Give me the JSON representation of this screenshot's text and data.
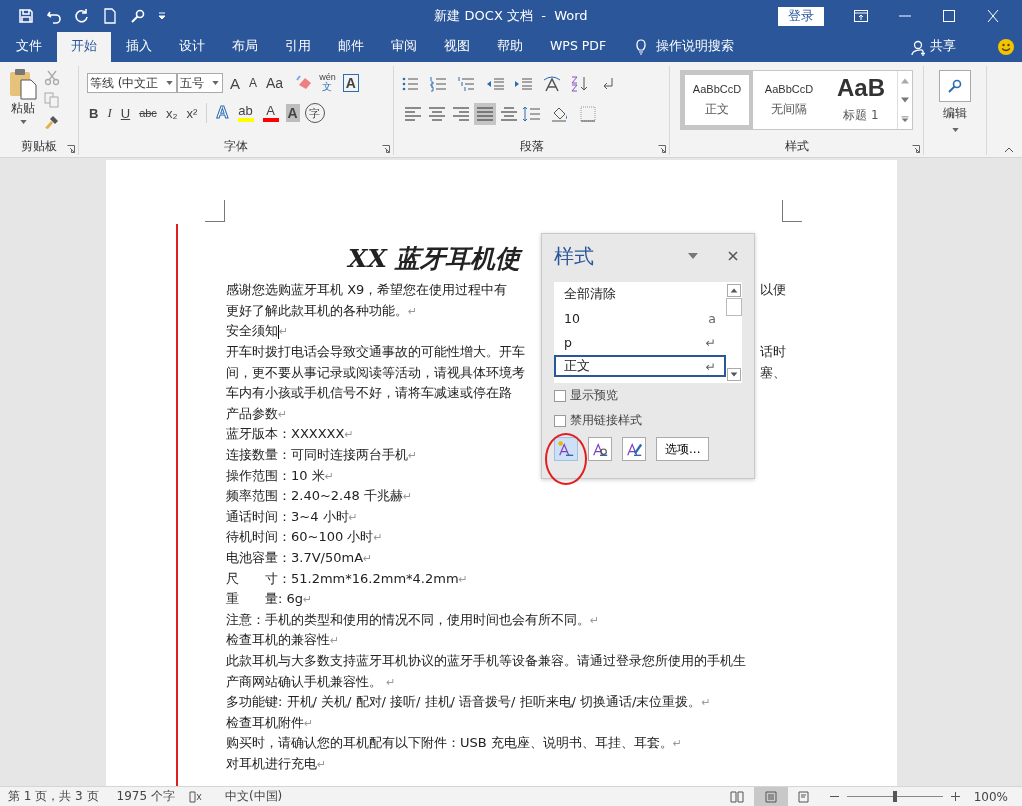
{
  "window": {
    "title": "新建 DOCX 文档  -  Word",
    "login": "登录"
  },
  "tabs": [
    {
      "label": "文件",
      "selected": false
    },
    {
      "label": "开始",
      "selected": true
    },
    {
      "label": "插入",
      "selected": false
    },
    {
      "label": "设计",
      "selected": false
    },
    {
      "label": "布局",
      "selected": false
    },
    {
      "label": "引用",
      "selected": false
    },
    {
      "label": "邮件",
      "selected": false
    },
    {
      "label": "审阅",
      "selected": false
    },
    {
      "label": "视图",
      "selected": false
    },
    {
      "label": "帮助",
      "selected": false
    },
    {
      "label": "WPS PDF",
      "selected": false
    }
  ],
  "tell_me": "操作说明搜索",
  "share": "共享",
  "clipboard": {
    "paste": "粘贴",
    "group": "剪贴板"
  },
  "font": {
    "name": "等线 (中文正",
    "size": "五号",
    "group": "字体",
    "row1": [
      "A",
      "A",
      "Aa"
    ],
    "phonetic": "wén",
    "phonetic_char": "文",
    "boxed": "A",
    "row2": [
      {
        "label": "B",
        "kind": "bold"
      },
      {
        "label": "I",
        "kind": "italic"
      },
      {
        "label": "U",
        "kind": "underline"
      },
      {
        "label": "abc",
        "kind": "strike"
      },
      {
        "label": "x₂",
        "kind": "plain"
      },
      {
        "label": "x²",
        "kind": "plain"
      }
    ],
    "row3": [
      {
        "label": "A",
        "kind": "effect"
      },
      {
        "label": "ab",
        "kind": "highlight",
        "color": "#ffff00"
      },
      {
        "label": "A",
        "kind": "fontcolor",
        "color": "#ff0000"
      },
      {
        "label": "A",
        "kind": "shade"
      },
      {
        "label": "字",
        "kind": "circle"
      }
    ]
  },
  "paragraph": {
    "group": "段落",
    "alignment": [
      {
        "kind": "left",
        "selected": false
      },
      {
        "kind": "center",
        "selected": false
      },
      {
        "kind": "right",
        "selected": false
      },
      {
        "kind": "justify",
        "selected": true
      },
      {
        "kind": "distribute",
        "selected": false
      }
    ]
  },
  "styles": {
    "group": "样式",
    "items": [
      {
        "preview": "AaBbCcD",
        "label": "正文",
        "kind": "normal",
        "selected": true
      },
      {
        "preview": "AaBbCcD",
        "label": "无间隔",
        "kind": "normal",
        "selected": false
      },
      {
        "preview": "AaB",
        "label": "标题 1",
        "kind": "heading",
        "selected": false
      }
    ]
  },
  "editing": {
    "label": "编辑"
  },
  "document": {
    "title": "XX 蓝牙耳机使",
    "lines": [
      {
        "text": "感谢您选购蓝牙耳机 X9，希望您在使用过程中有",
        "tail": "以便"
      },
      {
        "text": "更好了解此款耳机的各种功能。",
        "end": "↵"
      },
      {
        "text": "安全须知",
        "end": "↵",
        "cursor": true
      },
      {
        "text": "开车时拨打电话会导致交通事故的可能性增大。开车",
        "tail": "话时"
      },
      {
        "text": "间，更不要从事记录或阅读等活动，请视具体环境考",
        "tail": "塞、"
      },
      {
        "text": "车内有小孩或手机信号不好，请将车减速或停在路"
      },
      {
        "text": "产品参数",
        "end": "↵"
      },
      {
        "text": "蓝牙版本：XXXXXX",
        "end": "↵"
      },
      {
        "text": "连接数量：可同时连接两台手机",
        "end": "↵"
      },
      {
        "text": "操作范围：10 米",
        "end": "↵"
      },
      {
        "text": "频率范围：2.40~2.48 千兆赫",
        "end": "↵"
      },
      {
        "text": "通话时间：3~4 小时",
        "end": "↵"
      },
      {
        "text": "待机时间：60~100 小时",
        "end": "↵"
      },
      {
        "text": "电池容量：3.7V/50mA",
        "end": "↵"
      },
      {
        "text": "尺　　寸：51.2mm*16.2mm*4.2mm",
        "end": "↵"
      },
      {
        "text": "重　　量: 6g",
        "end": "↵"
      },
      {
        "text": "注意：手机的类型和使用的情况不同，使用时间也会有所不同。",
        "end": "↵"
      },
      {
        "text": "检查耳机的兼容性",
        "end": "↵"
      },
      {
        "text": "此款耳机与大多数支持蓝牙耳机协议的蓝牙手机等设备兼容。请通过登录您所使用的手机生"
      },
      {
        "text": "产商网站确认手机兼容性。 ",
        "end": "↵"
      },
      {
        "text": "多功能键: 开机/ 关机/ 配对/ 接听/ 挂机/ 语音拨号/ 拒听来电/ 切换通话/末位重拨。",
        "end": "↵"
      },
      {
        "text": "检查耳机附件",
        "end": "↵"
      },
      {
        "text": "购买时，请确认您的耳机配有以下附件：USB 充电座、说明书、耳挂、耳套。",
        "end": "↵"
      },
      {
        "text": "对耳机进行充电",
        "end": "↵"
      }
    ]
  },
  "styles_pane": {
    "title": "样式",
    "items": [
      {
        "label": "全部清除",
        "selected": false
      },
      {
        "label": "10",
        "mark": "a",
        "selected": false
      },
      {
        "label": "p",
        "mark": "↵",
        "selected": false
      },
      {
        "label": "正文",
        "mark": "↵",
        "selected": true
      }
    ],
    "checkboxes": [
      {
        "label": "显示预览",
        "checked": false
      },
      {
        "label": "禁用链接样式",
        "checked": false
      }
    ],
    "tools": [
      {
        "kind": "new",
        "selected": true
      },
      {
        "kind": "inspect",
        "selected": false
      },
      {
        "kind": "manage",
        "selected": false
      }
    ],
    "options": "选项..."
  },
  "status_bar": {
    "page": "第 1 页，共 3 页",
    "words": "1975 个字",
    "language": "中文(中国)",
    "views": [
      {
        "kind": "read",
        "selected": false
      },
      {
        "kind": "print",
        "selected": true
      },
      {
        "kind": "web",
        "selected": false
      }
    ],
    "zoom": {
      "level": 0.5,
      "reading": "100%"
    }
  }
}
